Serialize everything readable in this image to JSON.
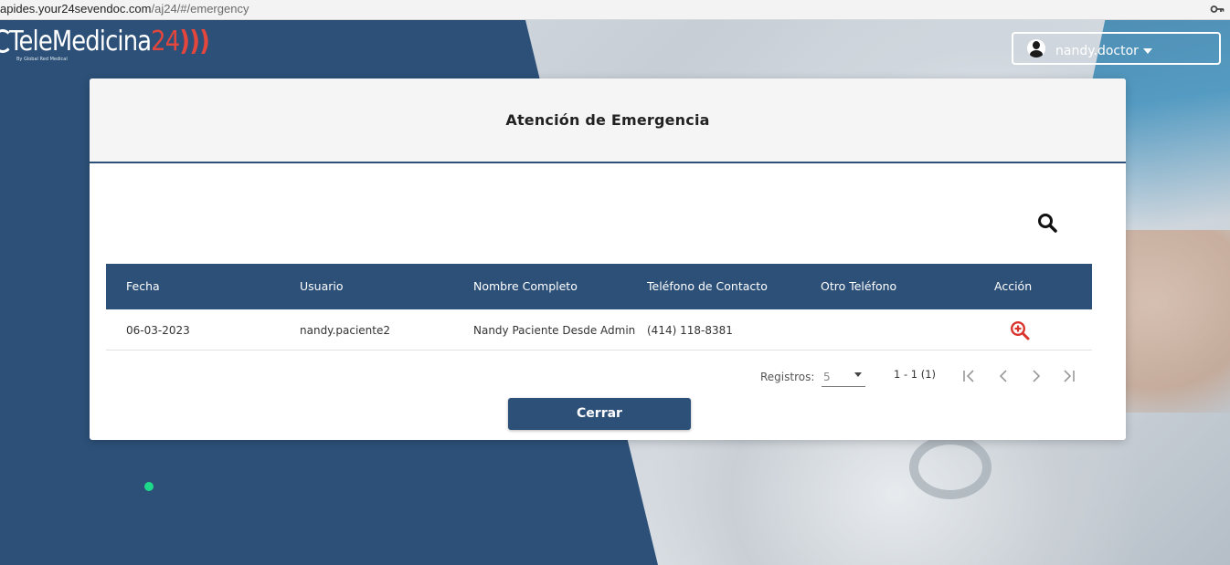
{
  "browser": {
    "url_host": "apides.your24sevendoc.com",
    "url_path": "/aj24/#/emergency",
    "key_icon": "key-icon"
  },
  "logo": {
    "text_main": "TeleMedicina",
    "text_num": "24",
    "tagline": "By Global Red Medical"
  },
  "user_menu": {
    "username": "nandy.doctor",
    "icon": "avatar-icon"
  },
  "modal": {
    "title": "Atención de Emergencia",
    "search_icon": "search-icon",
    "table": {
      "columns": [
        "Fecha",
        "Usuario",
        "Nombre Completo",
        "Teléfono de Contacto",
        "Otro Teléfono",
        "Acción"
      ],
      "rows": [
        {
          "fecha": "06-03-2023",
          "usuario": "nandy.paciente2",
          "nombre": "Nandy Paciente Desde Admin",
          "telefono": "(414) 118-8381",
          "otro_telefono": "",
          "accion_icon": "zoom-in-icon"
        }
      ]
    },
    "paginator": {
      "label": "Registros:",
      "page_size": "5",
      "range": "1 - 1 (1)"
    },
    "close_label": "Cerrar"
  },
  "colors": {
    "primary": "#2c5078",
    "accent_red": "#e2463d",
    "status_dot": "#1fd98a"
  }
}
